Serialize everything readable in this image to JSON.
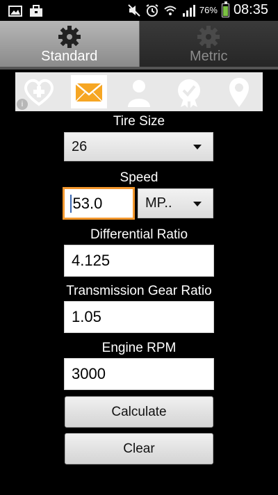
{
  "status_bar": {
    "left_icons": [
      "gallery-icon",
      "briefcase-icon"
    ],
    "right_icons": [
      "mute-icon",
      "alarm-icon",
      "wifi-icon",
      "signal-icon"
    ],
    "battery_percent": "76%",
    "battery_level": 0.76,
    "time": "08:35"
  },
  "tabs": [
    {
      "label": "Standard",
      "icon": "gear-icon",
      "selected": true
    },
    {
      "label": "Metric",
      "icon": "gear-icon",
      "selected": false
    }
  ],
  "ad_banner": {
    "icons": [
      "heart-plus-icon",
      "envelope-icon",
      "person-icon",
      "badge-check-icon",
      "location-pin-icon"
    ],
    "info_label": "i"
  },
  "form": {
    "tire_size": {
      "label": "Tire Size",
      "value": "26"
    },
    "speed": {
      "label": "Speed",
      "value": "53.0",
      "unit": "MP.."
    },
    "differential_ratio": {
      "label": "Differential Ratio",
      "value": "4.125"
    },
    "transmission_gear_ratio": {
      "label": "Transmission Gear Ratio",
      "value": "1.05"
    },
    "engine_rpm": {
      "label": "Engine RPM",
      "value": "3000"
    }
  },
  "buttons": {
    "calculate": "Calculate",
    "clear": "Clear"
  },
  "colors": {
    "background": "#000000",
    "focus_border": "#f3972d",
    "battery_fill": "#7bc043"
  }
}
